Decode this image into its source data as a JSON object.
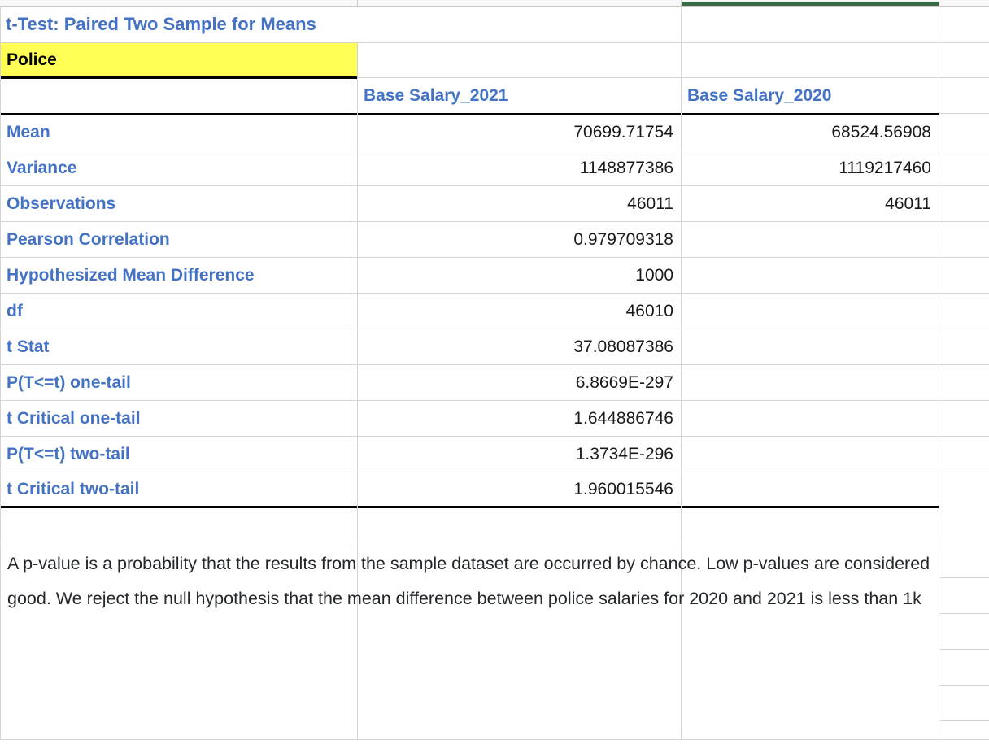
{
  "sheet": {
    "title": "t-Test: Paired Two Sample for Means",
    "group_label": "Police",
    "blank_label": "",
    "accent_color": "#4472C4",
    "highlight_color": "#FFFF55",
    "selected_column_color": "#3A6B47",
    "text_color": "#23272B"
  },
  "table": {
    "columns": [
      {
        "key": "col_a",
        "header": ""
      },
      {
        "key": "col_b",
        "header": "Base Salary_2021"
      },
      {
        "key": "col_c",
        "header": "Base Salary_2020"
      },
      {
        "key": "col_d",
        "header": ""
      }
    ],
    "rows": [
      {
        "label": "Mean",
        "v2021": "70699.71754",
        "v2020": "68524.56908"
      },
      {
        "label": "Variance",
        "v2021": "1148877386",
        "v2020": "1119217460"
      },
      {
        "label": "Observations",
        "v2021": "46011",
        "v2020": "46011"
      },
      {
        "label": "Pearson Correlation",
        "v2021": "0.979709318",
        "v2020": ""
      },
      {
        "label": "Hypothesized Mean Difference",
        "v2021": "1000",
        "v2020": ""
      },
      {
        "label": "df",
        "v2021": "46010",
        "v2020": ""
      },
      {
        "label": "t Stat",
        "v2021": "37.08087386",
        "v2020": ""
      },
      {
        "label": "P(T<=t) one-tail",
        "v2021": "6.8669E-297",
        "v2020": ""
      },
      {
        "label": "t Critical one-tail",
        "v2021": "1.644886746",
        "v2020": ""
      },
      {
        "label": "P(T<=t) two-tail",
        "v2021": "1.3734E-296",
        "v2020": ""
      },
      {
        "label": "t Critical two-tail",
        "v2021": "1.960015546",
        "v2020": ""
      }
    ]
  },
  "note": {
    "text": "A p-value is a probability that the results from the sample dataset are occurred by chance. Low p-values are considered good. We reject the null hypothesis that the mean difference between police salaries for 2020 and 2021 is less than 1k"
  }
}
